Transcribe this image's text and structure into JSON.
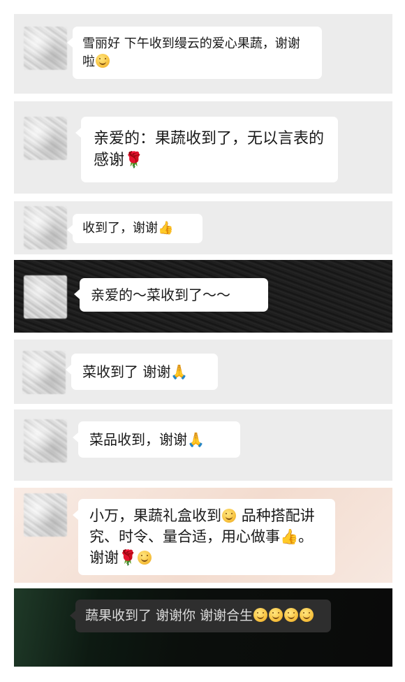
{
  "messages": [
    {
      "text": "雪丽好 下午收到缦云的爱心果蔬，谢谢啦",
      "emoji": "smile-icon"
    },
    {
      "text": "亲爱的：果蔬收到了，无以言表的感谢",
      "emoji": "rose-icon"
    },
    {
      "text": "收到了，谢谢",
      "emoji": "thumbs-up-icon"
    },
    {
      "text": "亲爱的～菜收到了～～"
    },
    {
      "text": "菜收到了 谢谢",
      "emoji": "pray-icon"
    },
    {
      "text": "菜品收到，谢谢",
      "emoji": "pray-icon"
    },
    {
      "text_1": "小万，果蔬礼盒收到",
      "text_2": "品种搭配讲究、时令、量合适，用心做事",
      "text_3": "。谢谢"
    },
    {
      "text": "蔬果收到了 谢谢你 谢谢合生"
    }
  ],
  "colors": {
    "panel_gray": "#ececec",
    "panel_dark": "#1e1e1e",
    "panel_peach": "#f6e6de",
    "panel_forest": "#0f1a14",
    "bubble": "#ffffff",
    "bubble_dark": "#2e2e2e"
  }
}
